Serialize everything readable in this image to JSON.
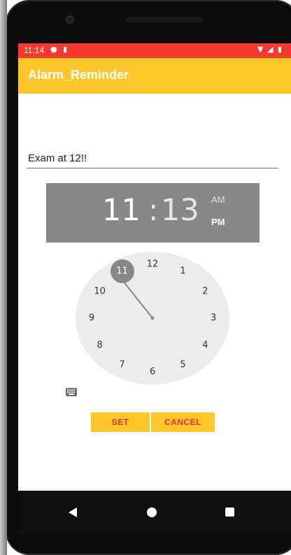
{
  "status_bar": {
    "time": "11:14",
    "icons_left": [
      "notification-icon",
      "sd-card-icon"
    ],
    "icons_right": [
      "wifi-icon",
      "signal-icon",
      "battery-icon"
    ],
    "color": "#f43a2f"
  },
  "app_bar": {
    "title": "Alarm_Reminder",
    "color": "#ffc62c"
  },
  "reminder": {
    "value": "Exam at 12!!"
  },
  "time_picker": {
    "hour": "11",
    "colon": ":",
    "minute": "13",
    "am_label": "AM",
    "pm_label": "PM",
    "selected_period": "PM",
    "dial_numbers": [
      "12",
      "1",
      "2",
      "3",
      "4",
      "5",
      "6",
      "7",
      "8",
      "9",
      "10",
      "11"
    ],
    "selected_hour": "11"
  },
  "buttons": {
    "set": "SET",
    "cancel": "CANCEL"
  },
  "navigation": {
    "items": [
      "back-icon",
      "home-icon",
      "recent-apps-icon"
    ]
  }
}
